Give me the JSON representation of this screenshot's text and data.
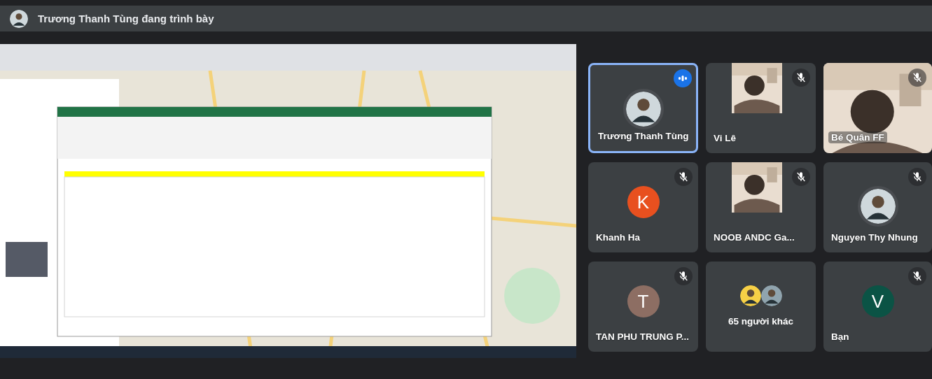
{
  "header": {
    "title": "Trương Thanh Tùng đang trình bày"
  },
  "participants": [
    {
      "name": "Trương Thanh Tùng",
      "muted": false,
      "speaking": true
    },
    {
      "name": "Vi Lê",
      "kind": "portrait_video",
      "muted": true,
      "speaking": false
    },
    {
      "name": "Bé Quân FF",
      "kind": "video",
      "muted": true,
      "speaking": false
    },
    {
      "name": "Khanh Ha",
      "kind": "letter",
      "initial": "K",
      "color": "#e8501f",
      "muted": true,
      "speaking": false
    },
    {
      "name": "NOOB ANDC Ga...",
      "kind": "portrait_video",
      "muted": true,
      "speaking": false
    },
    {
      "name": "Nguyen Thy Nhung",
      "muted": true,
      "speaking": false
    },
    {
      "name": "TAN PHU TRUNG P...",
      "kind": "letter",
      "initial": "T",
      "color": "#8d6e63",
      "muted": true,
      "speaking": false
    },
    {
      "name": "65 người khác",
      "kind": "others"
    },
    {
      "name": "Bạn",
      "kind": "letter",
      "initial": "V",
      "color": "#0b5345",
      "muted": true,
      "speaking": false
    }
  ]
}
